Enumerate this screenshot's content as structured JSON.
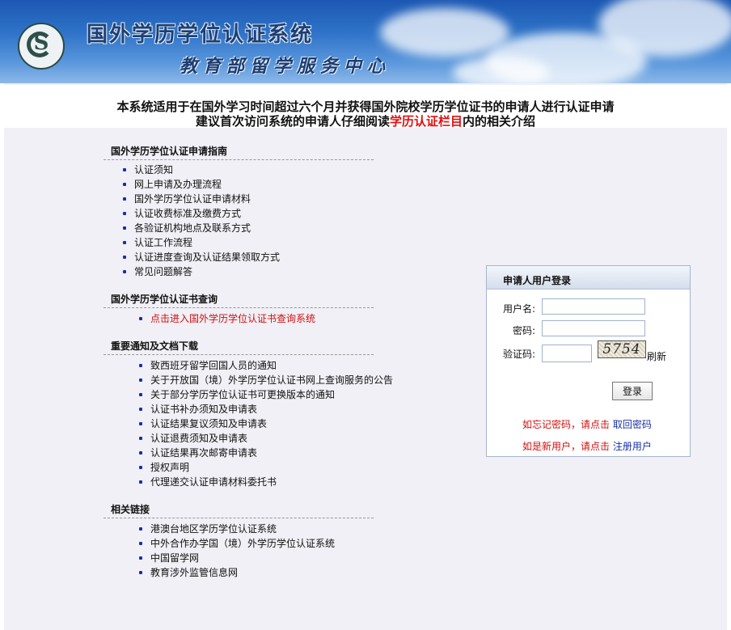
{
  "header": {
    "title": "国外学历学位认证系统",
    "subtitle": "教育部留学服务中心"
  },
  "notice": {
    "line1": "本系统适用于在国外学习时间超过六个月并获得国外院校学历学位证书的申请人进行认证申请",
    "line2_before": "建议首次访问系统的申请人仔细阅读",
    "line2_highlight": "学历认证栏目",
    "line2_after": "内的相关介绍"
  },
  "sections": {
    "guide": {
      "title": "国外学历学位认证申请指南",
      "items": [
        "认证须知",
        "网上申请及办理流程",
        "国外学历学位认证申请材料",
        "认证收费标准及缴费方式",
        "各验证机构地点及联系方式",
        "认证工作流程",
        "认证进度查询及认证结果领取方式",
        "常见问题解答"
      ]
    },
    "query": {
      "title": "国外学历学位认证书查询",
      "items": [
        "点击进入国外学历学位认证书查询系统"
      ]
    },
    "notices": {
      "title": "重要通知及文档下载",
      "items": [
        "致西班牙留学回国人员的通知",
        "关于开放国（境）外学历学位认证书网上查询服务的公告",
        "关于部分学历学位认证书可更换版本的通知",
        "认证书补办须知及申请表",
        "认证结果复议须知及申请表",
        "认证退费须知及申请表",
        "认证结果再次邮寄申请表",
        "授权声明",
        "代理递交认证申请材料委托书"
      ]
    },
    "links": {
      "title": "相关链接",
      "items": [
        "港澳台地区学历学位认证系统",
        "中外合作办学国（境）外学历学位认证系统",
        "中国留学网",
        "教育涉外监管信息网"
      ]
    }
  },
  "login": {
    "title": "申请人用户登录",
    "username_label": "用户名:",
    "password_label": "密码:",
    "captcha_label": "验证码:",
    "captcha_text": "5754",
    "refresh_label": "刷新",
    "login_button": "登录",
    "forgot_prefix": "如忘记密码，请点击",
    "forgot_link": "取回密码",
    "register_prefix": "如是新用户，请点击",
    "register_link": "注册用户"
  },
  "colors": {
    "highlight_red": "#e01010",
    "link_blue": "#1a2fa8",
    "banner_blue": "#2f73c8"
  }
}
